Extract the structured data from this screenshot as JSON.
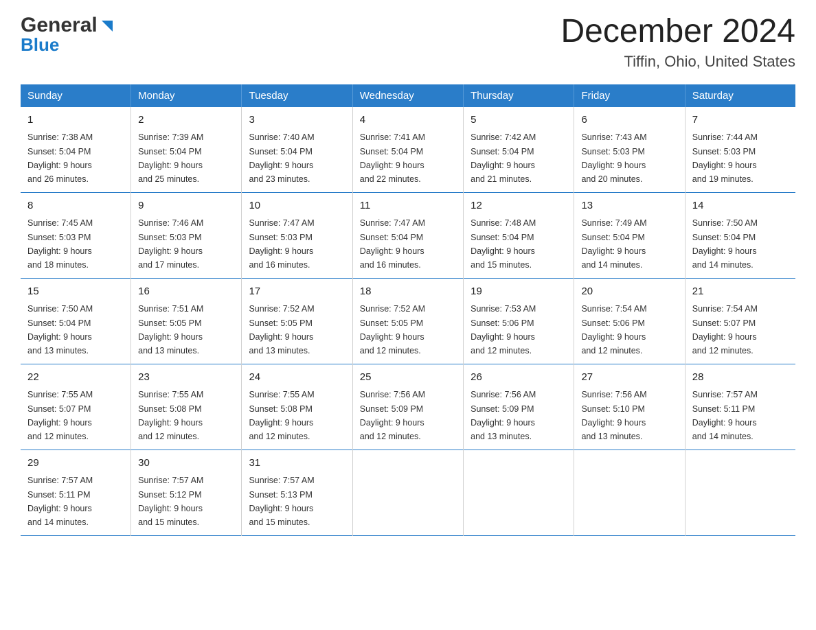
{
  "logo": {
    "general": "General",
    "blue": "Blue"
  },
  "title": {
    "month_year": "December 2024",
    "location": "Tiffin, Ohio, United States"
  },
  "weekdays": [
    "Sunday",
    "Monday",
    "Tuesday",
    "Wednesday",
    "Thursday",
    "Friday",
    "Saturday"
  ],
  "weeks": [
    [
      {
        "day": "1",
        "sunrise": "7:38 AM",
        "sunset": "5:04 PM",
        "daylight": "9 hours and 26 minutes."
      },
      {
        "day": "2",
        "sunrise": "7:39 AM",
        "sunset": "5:04 PM",
        "daylight": "9 hours and 25 minutes."
      },
      {
        "day": "3",
        "sunrise": "7:40 AM",
        "sunset": "5:04 PM",
        "daylight": "9 hours and 23 minutes."
      },
      {
        "day": "4",
        "sunrise": "7:41 AM",
        "sunset": "5:04 PM",
        "daylight": "9 hours and 22 minutes."
      },
      {
        "day": "5",
        "sunrise": "7:42 AM",
        "sunset": "5:04 PM",
        "daylight": "9 hours and 21 minutes."
      },
      {
        "day": "6",
        "sunrise": "7:43 AM",
        "sunset": "5:03 PM",
        "daylight": "9 hours and 20 minutes."
      },
      {
        "day": "7",
        "sunrise": "7:44 AM",
        "sunset": "5:03 PM",
        "daylight": "9 hours and 19 minutes."
      }
    ],
    [
      {
        "day": "8",
        "sunrise": "7:45 AM",
        "sunset": "5:03 PM",
        "daylight": "9 hours and 18 minutes."
      },
      {
        "day": "9",
        "sunrise": "7:46 AM",
        "sunset": "5:03 PM",
        "daylight": "9 hours and 17 minutes."
      },
      {
        "day": "10",
        "sunrise": "7:47 AM",
        "sunset": "5:03 PM",
        "daylight": "9 hours and 16 minutes."
      },
      {
        "day": "11",
        "sunrise": "7:47 AM",
        "sunset": "5:04 PM",
        "daylight": "9 hours and 16 minutes."
      },
      {
        "day": "12",
        "sunrise": "7:48 AM",
        "sunset": "5:04 PM",
        "daylight": "9 hours and 15 minutes."
      },
      {
        "day": "13",
        "sunrise": "7:49 AM",
        "sunset": "5:04 PM",
        "daylight": "9 hours and 14 minutes."
      },
      {
        "day": "14",
        "sunrise": "7:50 AM",
        "sunset": "5:04 PM",
        "daylight": "9 hours and 14 minutes."
      }
    ],
    [
      {
        "day": "15",
        "sunrise": "7:50 AM",
        "sunset": "5:04 PM",
        "daylight": "9 hours and 13 minutes."
      },
      {
        "day": "16",
        "sunrise": "7:51 AM",
        "sunset": "5:05 PM",
        "daylight": "9 hours and 13 minutes."
      },
      {
        "day": "17",
        "sunrise": "7:52 AM",
        "sunset": "5:05 PM",
        "daylight": "9 hours and 13 minutes."
      },
      {
        "day": "18",
        "sunrise": "7:52 AM",
        "sunset": "5:05 PM",
        "daylight": "9 hours and 12 minutes."
      },
      {
        "day": "19",
        "sunrise": "7:53 AM",
        "sunset": "5:06 PM",
        "daylight": "9 hours and 12 minutes."
      },
      {
        "day": "20",
        "sunrise": "7:54 AM",
        "sunset": "5:06 PM",
        "daylight": "9 hours and 12 minutes."
      },
      {
        "day": "21",
        "sunrise": "7:54 AM",
        "sunset": "5:07 PM",
        "daylight": "9 hours and 12 minutes."
      }
    ],
    [
      {
        "day": "22",
        "sunrise": "7:55 AM",
        "sunset": "5:07 PM",
        "daylight": "9 hours and 12 minutes."
      },
      {
        "day": "23",
        "sunrise": "7:55 AM",
        "sunset": "5:08 PM",
        "daylight": "9 hours and 12 minutes."
      },
      {
        "day": "24",
        "sunrise": "7:55 AM",
        "sunset": "5:08 PM",
        "daylight": "9 hours and 12 minutes."
      },
      {
        "day": "25",
        "sunrise": "7:56 AM",
        "sunset": "5:09 PM",
        "daylight": "9 hours and 12 minutes."
      },
      {
        "day": "26",
        "sunrise": "7:56 AM",
        "sunset": "5:09 PM",
        "daylight": "9 hours and 13 minutes."
      },
      {
        "day": "27",
        "sunrise": "7:56 AM",
        "sunset": "5:10 PM",
        "daylight": "9 hours and 13 minutes."
      },
      {
        "day": "28",
        "sunrise": "7:57 AM",
        "sunset": "5:11 PM",
        "daylight": "9 hours and 14 minutes."
      }
    ],
    [
      {
        "day": "29",
        "sunrise": "7:57 AM",
        "sunset": "5:11 PM",
        "daylight": "9 hours and 14 minutes."
      },
      {
        "day": "30",
        "sunrise": "7:57 AM",
        "sunset": "5:12 PM",
        "daylight": "9 hours and 15 minutes."
      },
      {
        "day": "31",
        "sunrise": "7:57 AM",
        "sunset": "5:13 PM",
        "daylight": "9 hours and 15 minutes."
      },
      null,
      null,
      null,
      null
    ]
  ],
  "labels": {
    "sunrise_prefix": "Sunrise: ",
    "sunset_prefix": "Sunset: ",
    "daylight_prefix": "Daylight: "
  }
}
